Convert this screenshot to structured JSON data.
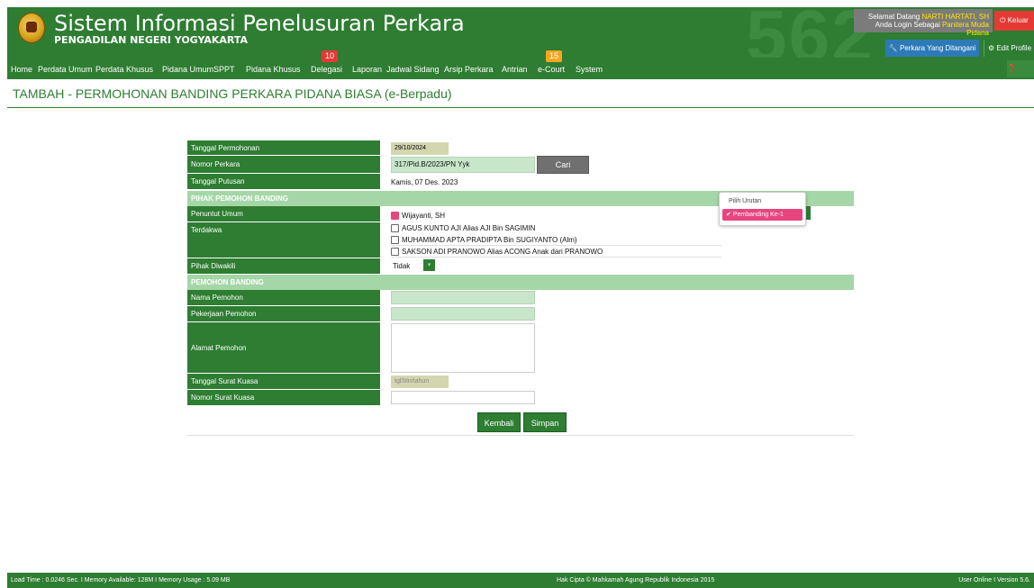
{
  "header": {
    "bg_number": "562",
    "title": "Sistem Informasi Penelusuran Perkara",
    "subtitle": "PENGADILAN NEGERI YOGYAKARTA",
    "welcome_prefix": "Selamat Datang",
    "user_name": "NARTI HARTATI, SH",
    "login_prefix": "Anda Login Sebagai",
    "role": "Panitera Muda Pidana",
    "logout_label": "⏻ Keluar",
    "perkara_button": "🔧 Perkara Yang Ditangani",
    "edit_profile_button": "⚙ Edit Profile"
  },
  "nav": {
    "items": [
      "Home",
      "Perdata Umum",
      "Perdata Khusus",
      "Pidana Umum",
      "SPPT",
      "Pidana Khusus",
      "Delegasi",
      "Laporan",
      "Jadwal Sidang",
      "Arsip Perkara",
      "Antrian",
      "e-Court",
      "System"
    ],
    "delegasi_badge": "10",
    "ecourt_badge": "15",
    "help_label": "❓ Help"
  },
  "page_title": "TAMBAH - PERMOHONAN BANDING PERKARA PIDANA BIASA (e-Berpadu)",
  "form": {
    "tanggal_permohonan_label": "Tanggal Permohonan",
    "tanggal_permohonan_value": "29/10/2024",
    "nomor_perkara_label": "Nomor Perkara",
    "nomor_perkara_value": "317/Pid.B/2023/PN Yyk",
    "cari_button": "Cari",
    "tanggal_putusan_label": "Tanggal Putusan",
    "tanggal_putusan_value": "Kamis, 07 Des. 2023",
    "section_pihak": "PIHAK PEMOHON BANDING",
    "penuntut_label": "Penuntut Umum",
    "penuntut_value": "Wijayanti, SH",
    "terdakwa_label": "Terdakwa",
    "terdakwa_list": [
      "AGUS KUNTO AJI Alias AJI Bin SAGIMIN",
      "MUHAMMAD APTA PRADIPTA Bin SUGIYANTO (Alm)",
      "SAKSON ADI PRANOWO Alias ACONG Anak dari PRANOWO"
    ],
    "pihak_diwakili_label": "Pihak Diwakili",
    "pihak_diwakili_value": "Tidak",
    "section_pemohon": "PEMOHON BANDING",
    "nama_pemohon_label": "Nama Pemohon",
    "pekerjaan_label": "Pekerjaan Pemohon",
    "alamat_label": "Alamat Pemohon",
    "tgl_surat_kuasa_label": "Tanggal Surat Kuasa",
    "tgl_surat_kuasa_placeholder": "tgl/bln/tahun",
    "nomor_surat_kuasa_label": "Nomor Surat Kuasa",
    "kembali_button": "Kembali",
    "simpan_button": "Simpan"
  },
  "urutan_dropdown": {
    "options": [
      "Pilih Urutan",
      "Pembanding Ke-1"
    ],
    "selected": "✔ Pembanding Ke-1"
  },
  "footer": {
    "left": "Load Time : 0.0246 Sec. I Memory Available: 128M I Memory Usage : 5.09 MB",
    "center": "Hak Cipta © Mahkamah Agung Republik Indonesia 2015",
    "right": "User Online I Version 5.6."
  },
  "colors": {
    "primary_green": "#2e7d32",
    "section_green": "#a5d6a7",
    "logout_red": "#e53935",
    "badge_orange": "#f5a623",
    "select_pink": "#e8457f"
  }
}
